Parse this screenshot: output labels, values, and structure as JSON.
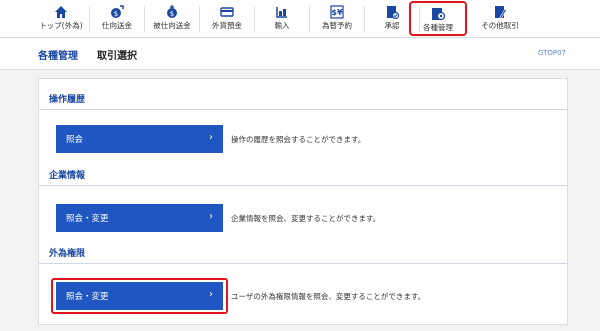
{
  "nav": {
    "items": [
      {
        "label": "トップ(外為)",
        "icon": "home-icon"
      },
      {
        "label": "仕向送金",
        "icon": "send-money-icon"
      },
      {
        "label": "被仕向送金",
        "icon": "receive-money-icon"
      },
      {
        "label": "外貨預金",
        "icon": "deposit-icon"
      },
      {
        "label": "輸入",
        "icon": "import-icon"
      },
      {
        "label": "為替予約",
        "icon": "exchange-icon"
      },
      {
        "label": "承認",
        "icon": "approval-icon"
      },
      {
        "label": "各種管理",
        "icon": "management-icon"
      },
      {
        "label": "その他取引",
        "icon": "other-transactions-icon"
      }
    ],
    "active_index": 7,
    "accent_color": "#1a47a0",
    "highlight_color": "#e0161b"
  },
  "header": {
    "title": "各種管理",
    "subtitle": "取引選択",
    "screen_code": "GTOP07"
  },
  "sections": [
    {
      "title": "操作履歴",
      "button_label": "照会",
      "description": "操作の履歴を照会することができます。"
    },
    {
      "title": "企業情報",
      "button_label": "照会・変更",
      "description": "企業情報を照会、変更することができます。"
    },
    {
      "title": "外為権限",
      "button_label": "照会・変更",
      "description": "ユーザの外為権限情報を照会、変更することができます。"
    }
  ],
  "chevron": "›",
  "button_color": "#1f56c2"
}
